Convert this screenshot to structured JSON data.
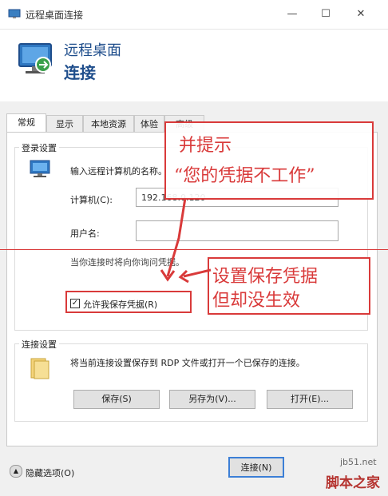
{
  "window": {
    "title": "远程桌面连接",
    "min_glyph": "—",
    "max_glyph": "☐",
    "close_glyph": "✕"
  },
  "header": {
    "line1": "远程桌面",
    "line2": "连接"
  },
  "tabs": [
    {
      "label": "常规",
      "active": true
    },
    {
      "label": "显示"
    },
    {
      "label": "本地资源"
    },
    {
      "label": "体验"
    },
    {
      "label": "高级"
    }
  ],
  "login": {
    "group_label": "登录设置",
    "prompt": "输入远程计算机的名称。",
    "computer_label": "计算机(C):",
    "computer_value": "192.168.0.120",
    "username_label": "用户名:",
    "username_value": "",
    "note": "当你连接时将向你询问凭据。",
    "save_cred_label": "允许我保存凭据(R)",
    "save_cred_checked": true
  },
  "connection": {
    "group_label": "连接设置",
    "text": "将当前连接设置保存到 RDP 文件或打开一个已保存的连接。",
    "save_btn": "保存(S)",
    "saveas_btn": "另存为(V)...",
    "open_btn": "打开(E)..."
  },
  "footer": {
    "hide_options": "隐藏选项(O)",
    "connect_btn": "连接(N)"
  },
  "annotations": {
    "a1_line1": "并提示",
    "a1_line2": "“您的凭据不工作”",
    "a2_line1": "设置保存凭据",
    "a2_line2": "但却没生效"
  },
  "watermark": {
    "site": "jb51.net",
    "name": "脚本之家"
  },
  "colors": {
    "accent": "#1f4e8c",
    "annotation": "#d93a3a"
  }
}
